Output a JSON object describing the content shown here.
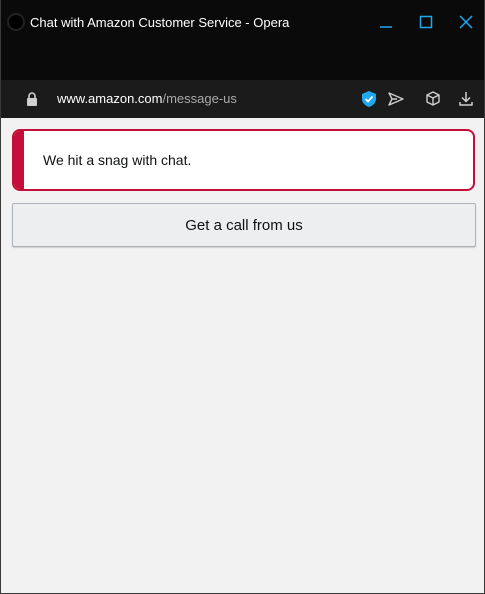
{
  "window": {
    "title": "Chat with Amazon Customer Service - Opera",
    "controls": {
      "minimize": "minimize-icon",
      "maximize": "maximize-icon",
      "close": "close-icon"
    }
  },
  "address_bar": {
    "url_host": "www.amazon.com",
    "url_path": "/message-us",
    "icons": [
      "lock-icon",
      "vpn-shield-icon",
      "send-icon",
      "snapshot-icon",
      "download-icon"
    ]
  },
  "alert": {
    "message": "We hit a snag with chat."
  },
  "actions": {
    "call_button_label": "Get a call from us"
  },
  "colors": {
    "titlebar": "#0a0a0a",
    "addressbar": "#1b1b1b",
    "accent_cyan": "#1fa8f0",
    "alert_red": "#c40f3b",
    "page_bg": "#f2f2f2"
  }
}
